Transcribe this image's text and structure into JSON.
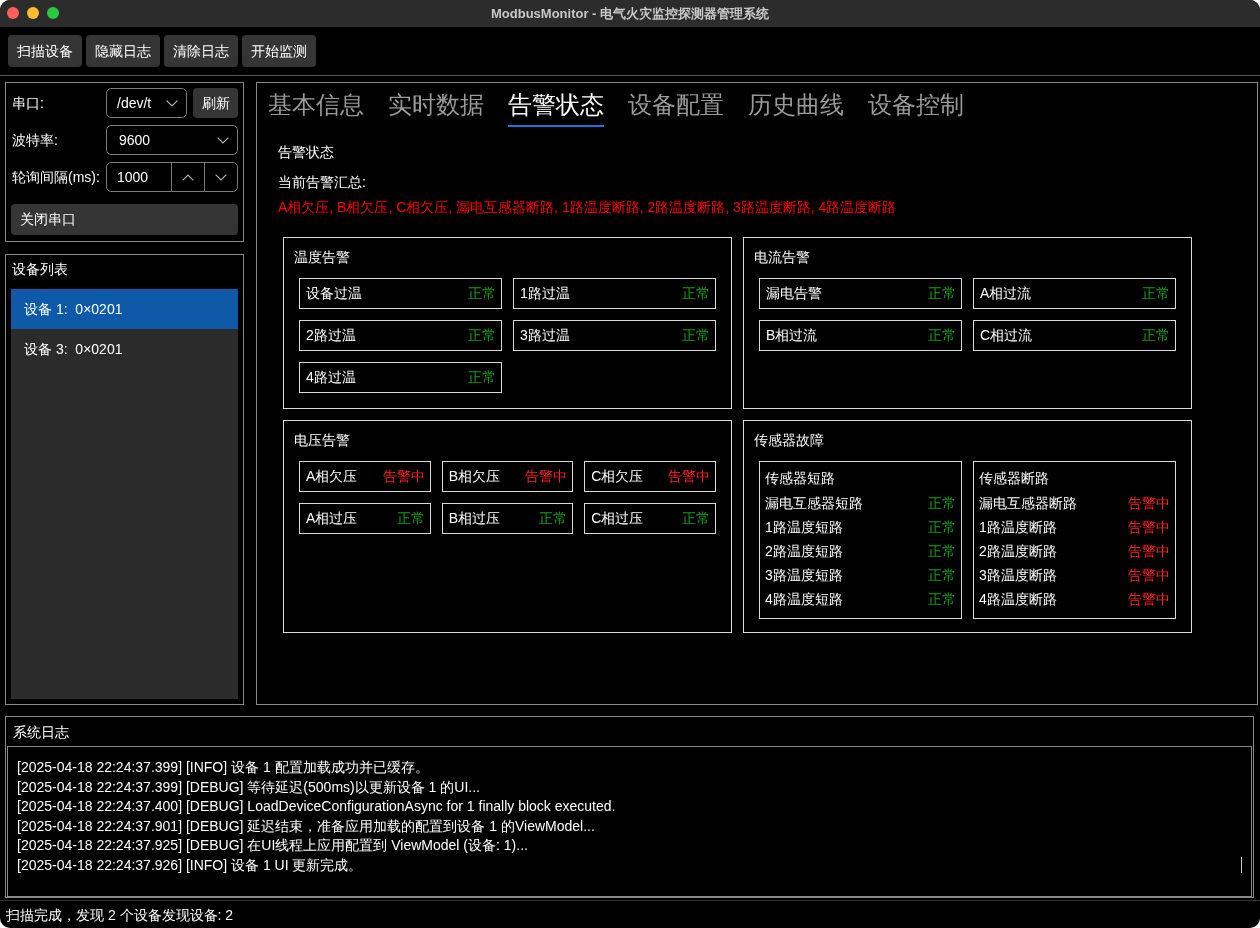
{
  "window": {
    "title": "ModbusMonitor - 电气火灾监控探测器管理系统"
  },
  "toolbar": {
    "buttons": [
      "扫描设备",
      "隐藏日志",
      "清除日志",
      "开始监测"
    ]
  },
  "connection": {
    "port": {
      "label": "串口:",
      "value": "/dev/t",
      "refresh_button": "刷新"
    },
    "baud_rate": {
      "label": "波特率:",
      "value": "9600"
    },
    "poll_interval": {
      "label": "轮询间隔(ms):",
      "value": "1000"
    },
    "close_button": "关闭串口"
  },
  "device_list": {
    "title": "设备列表",
    "items": [
      {
        "label": "设备 1:  0×0201",
        "selected": true
      },
      {
        "label": "设备 3:  0×0201",
        "selected": false
      }
    ]
  },
  "tabs": [
    {
      "label": "基本信息",
      "selected": false
    },
    {
      "label": "实时数据",
      "selected": false
    },
    {
      "label": "告警状态",
      "selected": true
    },
    {
      "label": "设备配置",
      "selected": false
    },
    {
      "label": "历史曲线",
      "selected": false
    },
    {
      "label": "设备控制",
      "selected": false
    }
  ],
  "alarm_page": {
    "heading": "告警状态",
    "summary_label": "当前告警汇总:",
    "summary": "A相欠压, B相欠压, C相欠压, 漏电互感器断路, 1路温度断路, 2路温度断路, 3路温度断路, 4路温度断路",
    "groups": [
      {
        "title": "温度告警",
        "kind": "tiles",
        "items": [
          {
            "label": "设备过温",
            "status": "正常",
            "alarm": false
          },
          {
            "label": "1路过温",
            "status": "正常",
            "alarm": false
          },
          {
            "label": "2路过温",
            "status": "正常",
            "alarm": false
          },
          {
            "label": "3路过温",
            "status": "正常",
            "alarm": false
          },
          {
            "label": "4路过温",
            "status": "正常",
            "alarm": false
          }
        ]
      },
      {
        "title": "电流告警",
        "kind": "tiles",
        "items": [
          {
            "label": "漏电告警",
            "status": "正常",
            "alarm": false
          },
          {
            "label": "A相过流",
            "status": "正常",
            "alarm": false
          },
          {
            "label": "B相过流",
            "status": "正常",
            "alarm": false
          },
          {
            "label": "C相过流",
            "status": "正常",
            "alarm": false
          }
        ]
      },
      {
        "title": "电压告警",
        "kind": "tiles",
        "items": [
          {
            "label": "A相欠压",
            "status": "告警中",
            "alarm": true
          },
          {
            "label": "B相欠压",
            "status": "告警中",
            "alarm": true
          },
          {
            "label": "C相欠压",
            "status": "告警中",
            "alarm": true
          },
          {
            "label": "A相过压",
            "status": "正常",
            "alarm": false
          },
          {
            "label": "B相过压",
            "status": "正常",
            "alarm": false
          },
          {
            "label": "C相过压",
            "status": "正常",
            "alarm": false
          }
        ]
      },
      {
        "title": "传感器故障",
        "kind": "lists",
        "sections": [
          {
            "title": "传感器短路",
            "items": [
              {
                "label": "漏电互感器短路",
                "status": "正常",
                "alarm": false
              },
              {
                "label": "1路温度短路",
                "status": "正常",
                "alarm": false
              },
              {
                "label": "2路温度短路",
                "status": "正常",
                "alarm": false
              },
              {
                "label": "3路温度短路",
                "status": "正常",
                "alarm": false
              },
              {
                "label": "4路温度短路",
                "status": "正常",
                "alarm": false
              }
            ]
          },
          {
            "title": "传感器断路",
            "items": [
              {
                "label": "漏电互感器断路",
                "status": "告警中",
                "alarm": true
              },
              {
                "label": "1路温度断路",
                "status": "告警中",
                "alarm": true
              },
              {
                "label": "2路温度断路",
                "status": "告警中",
                "alarm": true
              },
              {
                "label": "3路温度断路",
                "status": "告警中",
                "alarm": true
              },
              {
                "label": "4路温度断路",
                "status": "告警中",
                "alarm": true
              }
            ]
          }
        ]
      }
    ]
  },
  "log": {
    "title": "系统日志",
    "lines": [
      "[2025-04-18 22:24:37.399] [INFO] 设备 1 配置加载成功并已缓存。",
      "[2025-04-18 22:24:37.399] [DEBUG] 等待延迟(500ms)以更新设备 1 的UI...",
      "[2025-04-18 22:24:37.400] [DEBUG] LoadDeviceConfigurationAsync for 1 finally block executed.",
      "[2025-04-18 22:24:37.901] [DEBUG] 延迟结束，准备应用加载的配置到设备 1 的ViewModel...",
      "[2025-04-18 22:24:37.925] [DEBUG] 在UI线程上应用配置到 ViewModel (设备: 1)...",
      "[2025-04-18 22:24:37.926] [INFO] 设备 1 UI 更新完成。"
    ]
  },
  "status_bar": {
    "text": "扫描完成，发现 2 个设备发现设备: 2"
  }
}
